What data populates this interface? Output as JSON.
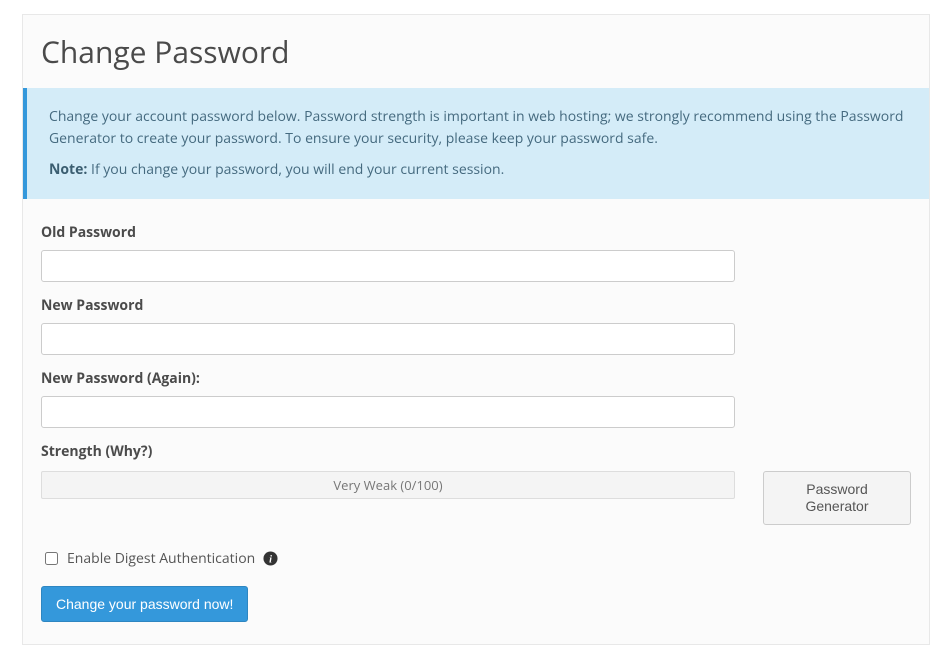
{
  "page": {
    "title": "Change Password"
  },
  "alert": {
    "intro": "Change your account password below. Password strength is important in web hosting; we strongly recommend using the Password Generator to create your password. To ensure your security, please keep your password safe.",
    "note_label": "Note:",
    "note_text": " If you change your password, you will end your current session."
  },
  "form": {
    "old_password": {
      "label": "Old Password",
      "value": ""
    },
    "new_password": {
      "label": "New Password",
      "value": ""
    },
    "new_password_again": {
      "label": "New Password (Again):",
      "value": ""
    },
    "strength": {
      "label_prefix": "Strength (",
      "why_text": "Why?",
      "label_suffix": ")",
      "meter_text": "Very Weak (0/100)",
      "score": 0,
      "max": 100
    },
    "password_generator_button": "Password Generator",
    "digest_auth": {
      "label": "Enable Digest Authentication",
      "checked": false
    },
    "submit_button": "Change your password now!"
  }
}
